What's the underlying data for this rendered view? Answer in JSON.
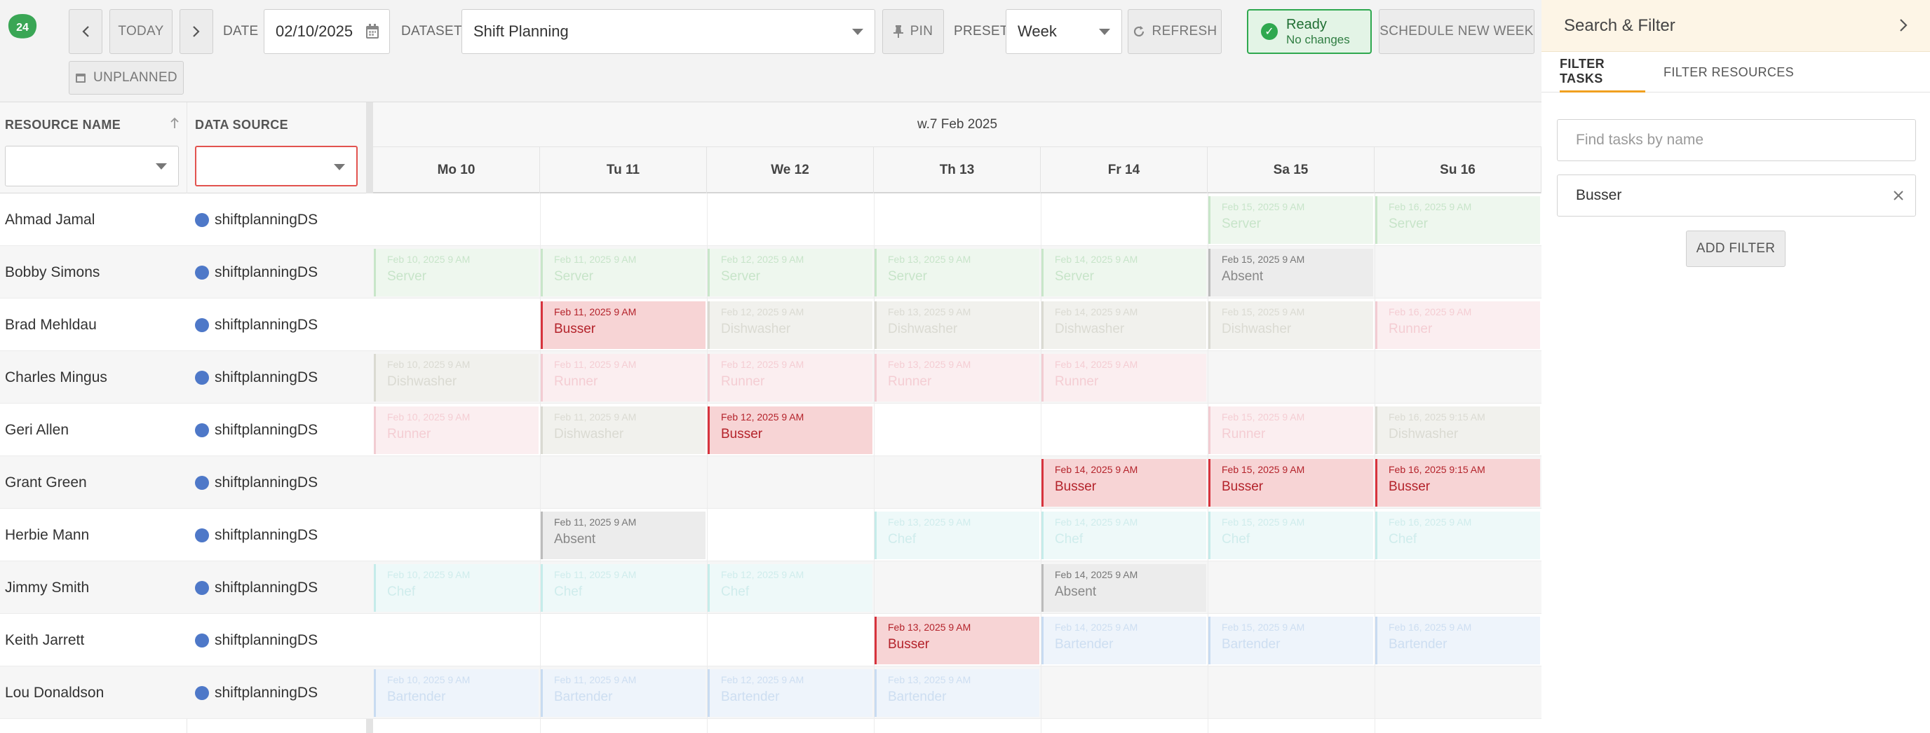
{
  "app": {
    "logo_text": "24"
  },
  "toolbar": {
    "prev_label": "‹",
    "today_label": "TODAY",
    "next_label": "›",
    "date_label": "DATE",
    "date_value": "02/10/2025",
    "dataset_label": "DATASET",
    "dataset_value": "Shift Planning",
    "pin_label": "PIN",
    "preset_label": "PRESET",
    "preset_value": "Week",
    "refresh_label": "REFRESH",
    "status_title": "Ready",
    "status_subtitle": "No changes",
    "schedule_label": "SCHEDULE NEW WEEK",
    "unplanned_label": "UNPLANNED"
  },
  "grid": {
    "col_resource": "RESOURCE NAME",
    "col_source": "DATA SOURCE",
    "week_label": "w.7 Feb 2025",
    "days": [
      "Mo 10",
      "Tu 11",
      "We 12",
      "Th 13",
      "Fr 14",
      "Sa 15",
      "Su 16"
    ],
    "rows": [
      {
        "name": "Ahmad Jamal",
        "source": "shiftplanningDS",
        "events": [
          {
            "day": 5,
            "date": "Feb 15, 2025 9 AM",
            "name": "Server",
            "kind": "server"
          },
          {
            "day": 6,
            "date": "Feb 16, 2025 9 AM",
            "name": "Server",
            "kind": "server"
          }
        ]
      },
      {
        "name": "Bobby Simons",
        "source": "shiftplanningDS",
        "events": [
          {
            "day": 0,
            "date": "Feb 10, 2025 9 AM",
            "name": "Server",
            "kind": "server"
          },
          {
            "day": 1,
            "date": "Feb 11, 2025 9 AM",
            "name": "Server",
            "kind": "server"
          },
          {
            "day": 2,
            "date": "Feb 12, 2025 9 AM",
            "name": "Server",
            "kind": "server"
          },
          {
            "day": 3,
            "date": "Feb 13, 2025 9 AM",
            "name": "Server",
            "kind": "server"
          },
          {
            "day": 4,
            "date": "Feb 14, 2025 9 AM",
            "name": "Server",
            "kind": "server"
          },
          {
            "day": 5,
            "date": "Feb 15, 2025 9 AM",
            "name": "Absent",
            "kind": "absent"
          }
        ]
      },
      {
        "name": "Brad Mehldau",
        "source": "shiftplanningDS",
        "events": [
          {
            "day": 1,
            "date": "Feb 11, 2025 9 AM",
            "name": "Busser",
            "kind": "busser"
          },
          {
            "day": 2,
            "date": "Feb 12, 2025 9 AM",
            "name": "Dishwasher",
            "kind": "dish"
          },
          {
            "day": 3,
            "date": "Feb 13, 2025 9 AM",
            "name": "Dishwasher",
            "kind": "dish"
          },
          {
            "day": 4,
            "date": "Feb 14, 2025 9 AM",
            "name": "Dishwasher",
            "kind": "dish"
          },
          {
            "day": 5,
            "date": "Feb 15, 2025 9 AM",
            "name": "Dishwasher",
            "kind": "dish"
          },
          {
            "day": 6,
            "date": "Feb 16, 2025 9 AM",
            "name": "Runner",
            "kind": "runner"
          }
        ]
      },
      {
        "name": "Charles Mingus",
        "source": "shiftplanningDS",
        "events": [
          {
            "day": 0,
            "date": "Feb 10, 2025 9 AM",
            "name": "Dishwasher",
            "kind": "dish"
          },
          {
            "day": 1,
            "date": "Feb 11, 2025 9 AM",
            "name": "Runner",
            "kind": "runner"
          },
          {
            "day": 2,
            "date": "Feb 12, 2025 9 AM",
            "name": "Runner",
            "kind": "runner"
          },
          {
            "day": 3,
            "date": "Feb 13, 2025 9 AM",
            "name": "Runner",
            "kind": "runner"
          },
          {
            "day": 4,
            "date": "Feb 14, 2025 9 AM",
            "name": "Runner",
            "kind": "runner"
          }
        ]
      },
      {
        "name": "Geri Allen",
        "source": "shiftplanningDS",
        "events": [
          {
            "day": 0,
            "date": "Feb 10, 2025 9 AM",
            "name": "Runner",
            "kind": "runner"
          },
          {
            "day": 1,
            "date": "Feb 11, 2025 9 AM",
            "name": "Dishwasher",
            "kind": "dish"
          },
          {
            "day": 2,
            "date": "Feb 12, 2025 9 AM",
            "name": "Busser",
            "kind": "busser"
          },
          {
            "day": 5,
            "date": "Feb 15, 2025 9 AM",
            "name": "Runner",
            "kind": "runner"
          },
          {
            "day": 6,
            "date": "Feb 16, 2025 9:15 AM",
            "name": "Dishwasher",
            "kind": "dish"
          }
        ]
      },
      {
        "name": "Grant Green",
        "source": "shiftplanningDS",
        "events": [
          {
            "day": 4,
            "date": "Feb 14, 2025 9 AM",
            "name": "Busser",
            "kind": "busser"
          },
          {
            "day": 5,
            "date": "Feb 15, 2025 9 AM",
            "name": "Busser",
            "kind": "busser"
          },
          {
            "day": 6,
            "date": "Feb 16, 2025 9:15 AM",
            "name": "Busser",
            "kind": "busser"
          }
        ]
      },
      {
        "name": "Herbie Mann",
        "source": "shiftplanningDS",
        "events": [
          {
            "day": 1,
            "date": "Feb 11, 2025 9 AM",
            "name": "Absent",
            "kind": "absent"
          },
          {
            "day": 3,
            "date": "Feb 13, 2025 9 AM",
            "name": "Chef",
            "kind": "chef"
          },
          {
            "day": 4,
            "date": "Feb 14, 2025 9 AM",
            "name": "Chef",
            "kind": "chef"
          },
          {
            "day": 5,
            "date": "Feb 15, 2025 9 AM",
            "name": "Chef",
            "kind": "chef"
          },
          {
            "day": 6,
            "date": "Feb 16, 2025 9 AM",
            "name": "Chef",
            "kind": "chef"
          }
        ]
      },
      {
        "name": "Jimmy Smith",
        "source": "shiftplanningDS",
        "events": [
          {
            "day": 0,
            "date": "Feb 10, 2025 9 AM",
            "name": "Chef",
            "kind": "chef"
          },
          {
            "day": 1,
            "date": "Feb 11, 2025 9 AM",
            "name": "Chef",
            "kind": "chef"
          },
          {
            "day": 2,
            "date": "Feb 12, 2025 9 AM",
            "name": "Chef",
            "kind": "chef"
          },
          {
            "day": 4,
            "date": "Feb 14, 2025 9 AM",
            "name": "Absent",
            "kind": "absent"
          }
        ]
      },
      {
        "name": "Keith Jarrett",
        "source": "shiftplanningDS",
        "events": [
          {
            "day": 3,
            "date": "Feb 13, 2025 9 AM",
            "name": "Busser",
            "kind": "busser"
          },
          {
            "day": 4,
            "date": "Feb 14, 2025 9 AM",
            "name": "Bartender",
            "kind": "bartender"
          },
          {
            "day": 5,
            "date": "Feb 15, 2025 9 AM",
            "name": "Bartender",
            "kind": "bartender"
          },
          {
            "day": 6,
            "date": "Feb 16, 2025 9 AM",
            "name": "Bartender",
            "kind": "bartender"
          }
        ]
      },
      {
        "name": "Lou Donaldson",
        "source": "shiftplanningDS",
        "events": [
          {
            "day": 0,
            "date": "Feb 10, 2025 9 AM",
            "name": "Bartender",
            "kind": "bartender"
          },
          {
            "day": 1,
            "date": "Feb 11, 2025 9 AM",
            "name": "Bartender",
            "kind": "bartender"
          },
          {
            "day": 2,
            "date": "Feb 12, 2025 9 AM",
            "name": "Bartender",
            "kind": "bartender"
          },
          {
            "day": 3,
            "date": "Feb 13, 2025 9 AM",
            "name": "Bartender",
            "kind": "bartender"
          }
        ]
      }
    ]
  },
  "panel": {
    "title": "Search & Filter",
    "tab_tasks": "FILTER TASKS",
    "tab_resources": "FILTER RESOURCES",
    "search_placeholder": "Find tasks by name",
    "active_filter": "Busser",
    "add_filter_label": "ADD FILTER"
  },
  "colors": {
    "accent": "#f0a020",
    "status_green": "#2fa84f",
    "busser_red": "#d7333d",
    "datasource_dot": "#4e78c8"
  }
}
